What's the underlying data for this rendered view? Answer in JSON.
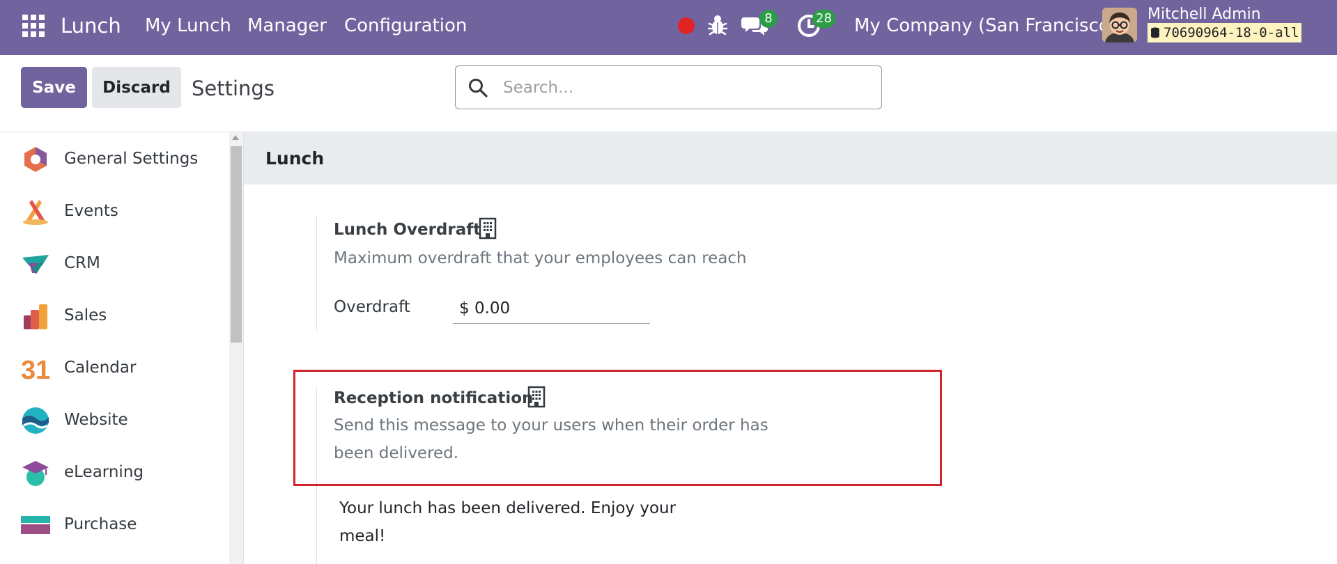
{
  "navbar": {
    "brand": "Lunch",
    "menu": [
      "My Lunch",
      "Manager",
      "Configuration"
    ],
    "message_count": "8",
    "activity_count": "28",
    "company": "My Company (San Francisco)",
    "user_name": "Mitchell Admin",
    "database": "70690964-18-0-all",
    "colors": {
      "navbar_bg": "#71639e",
      "badge": "#2a9d45",
      "recording": "#e02424"
    }
  },
  "control_panel": {
    "save_label": "Save",
    "discard_label": "Discard",
    "title": "Settings",
    "search_placeholder": "Search..."
  },
  "sidebar": {
    "items": [
      {
        "label": "General Settings",
        "icon": "general-settings-icon"
      },
      {
        "label": "Events",
        "icon": "events-icon"
      },
      {
        "label": "CRM",
        "icon": "crm-icon"
      },
      {
        "label": "Sales",
        "icon": "sales-icon"
      },
      {
        "label": "Calendar",
        "icon": "calendar-icon",
        "icon_text": "31"
      },
      {
        "label": "Website",
        "icon": "website-icon"
      },
      {
        "label": "eLearning",
        "icon": "elearning-icon"
      },
      {
        "label": "Purchase",
        "icon": "purchase-icon"
      }
    ]
  },
  "main": {
    "section_title": "Lunch",
    "overdraft_setting": {
      "title": "Lunch Overdraft",
      "description": "Maximum overdraft that your employees can reach",
      "field_label": "Overdraft",
      "field_value": "$ 0.00"
    },
    "reception_setting": {
      "title": "Reception notification",
      "description": "Send this message to your users when their order has been delivered.",
      "message": "Your lunch has been delivered. Enjoy your meal!"
    },
    "highlight_color": "#d1242f"
  }
}
